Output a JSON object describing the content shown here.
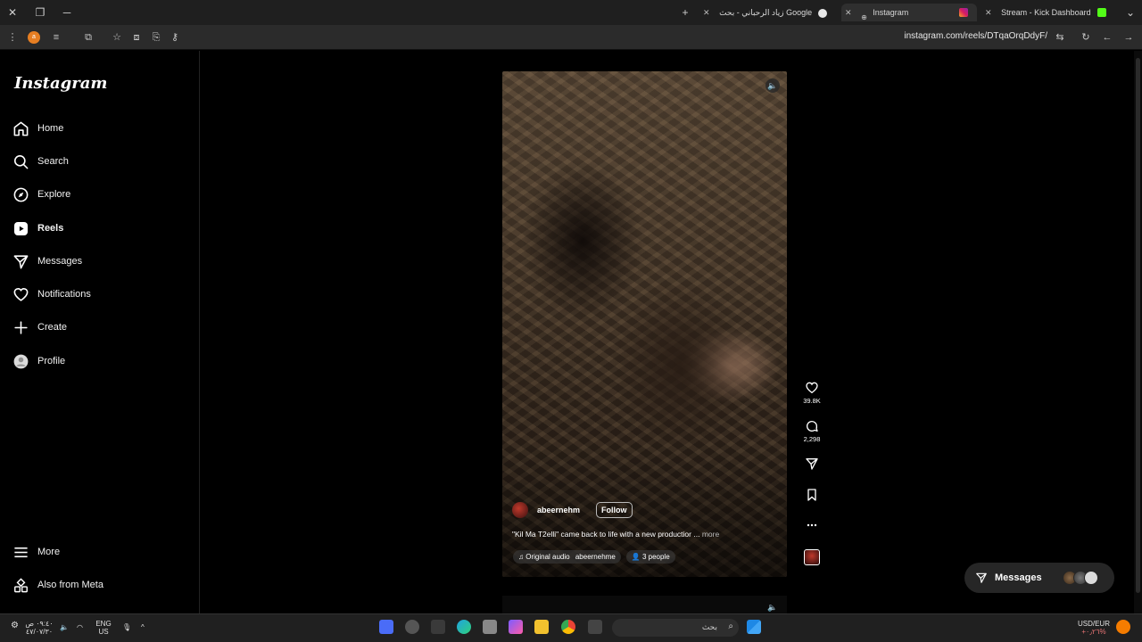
{
  "browser": {
    "tabs": [
      {
        "label": "Stream - Kick Dashboard",
        "favicon": "kick-icon"
      },
      {
        "label": "Instagram",
        "favicon": "instagram-icon",
        "active": true
      },
      {
        "label": "زياد الرحباني - بحث Google",
        "favicon": "google-icon"
      }
    ],
    "url": "instagram.com/reels/DTqaOrqDdyF/"
  },
  "instagram": {
    "logo": "Instagram",
    "nav": [
      {
        "label": "Home",
        "icon": "home-icon"
      },
      {
        "label": "Search",
        "icon": "search-icon"
      },
      {
        "label": "Explore",
        "icon": "compass-icon"
      },
      {
        "label": "Reels",
        "icon": "reels-icon"
      },
      {
        "label": "Messages",
        "icon": "send-icon"
      },
      {
        "label": "Notifications",
        "icon": "heart-icon"
      },
      {
        "label": "Create",
        "icon": "plus-icon"
      },
      {
        "label": "Profile",
        "icon": "avatar"
      }
    ],
    "nav_bottom": [
      {
        "label": "More",
        "icon": "menu-icon"
      },
      {
        "label": "Also from Meta",
        "icon": "meta-icon"
      }
    ],
    "reel": {
      "username": "abeernehm",
      "follow_label": "Follow",
      "caption": "\"Kil Ma T2elli\" came back to life with a new productior ...",
      "caption_more": "more",
      "audio_label": "Original audio",
      "audio_user": "abeernehme",
      "people_label": "3 people",
      "likes": "39.8K",
      "comments": "2,298"
    },
    "messages_pill": {
      "label": "Messages"
    }
  },
  "taskbar": {
    "time": "٠٩:٤٠ ص",
    "date": "٤٧/٠٧/٣٠",
    "lang_1": "ENG",
    "lang_2": "US",
    "search_placeholder": "بحث",
    "ticker": "USD/EUR",
    "ticker_value": "+٠٫٢٦%"
  }
}
